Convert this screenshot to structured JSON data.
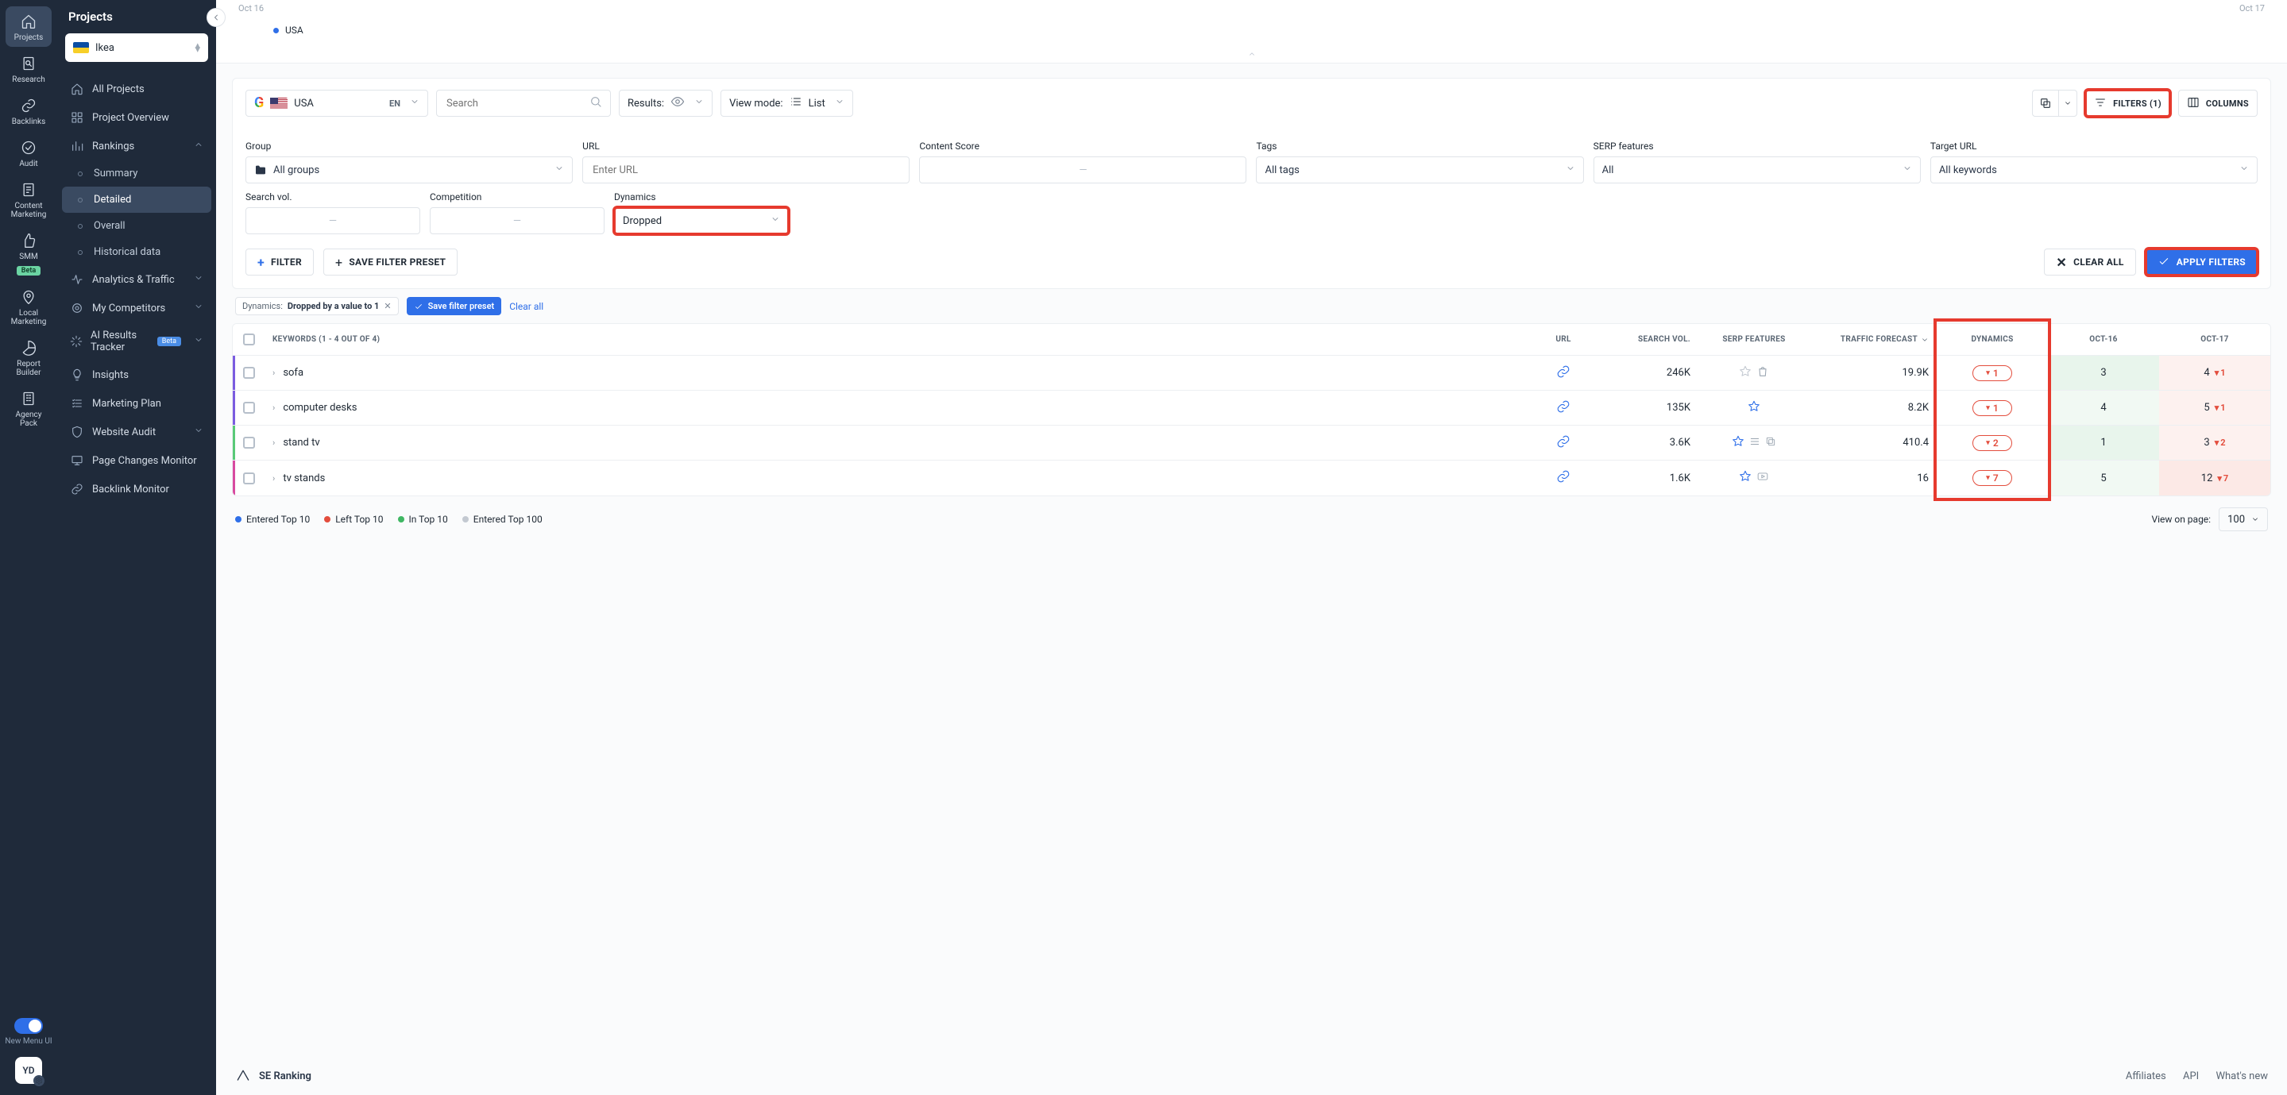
{
  "rail": {
    "items": [
      {
        "label": "Projects",
        "icon": "home-icon",
        "active": true
      },
      {
        "label": "Research",
        "icon": "search-doc-icon"
      },
      {
        "label": "Backlinks",
        "icon": "link-icon"
      },
      {
        "label": "Audit",
        "icon": "check-circle-icon"
      },
      {
        "label": "Content\nMarketing",
        "icon": "edit-doc-icon"
      },
      {
        "label": "SMM",
        "icon": "thumbs-up-icon",
        "beta": "Beta"
      },
      {
        "label": "Local\nMarketing",
        "icon": "pin-icon"
      },
      {
        "label": "Report\nBuilder",
        "icon": "pie-icon"
      },
      {
        "label": "Agency\nPack",
        "icon": "building-icon"
      }
    ],
    "toggle_label": "New Menu UI",
    "avatar": "YD"
  },
  "side": {
    "title": "Projects",
    "project": "Ikea",
    "nav_all": "All Projects",
    "nav_overview": "Project Overview",
    "nav_rankings": "Rankings",
    "rankings_children": [
      "Summary",
      "Detailed",
      "Overall",
      "Historical data"
    ],
    "rankings_selected_index": 1,
    "nav_analytics": "Analytics & Traffic",
    "nav_competitors": "My Competitors",
    "nav_ai": "AI Results Tracker",
    "nav_ai_badge": "Beta",
    "nav_insights": "Insights",
    "nav_marketing": "Marketing Plan",
    "nav_audit": "Website Audit",
    "nav_pagechanges": "Page Changes Monitor",
    "nav_backlink": "Backlink Monitor"
  },
  "top": {
    "date_left": "Oct 16",
    "date_right": "Oct 17",
    "legend_usa": "USA"
  },
  "toolbar": {
    "country": "USA",
    "lang": "EN",
    "search_placeholder": "Search",
    "results_label": "Results:",
    "viewmode_label": "View mode:",
    "viewmode_value": "List",
    "filters_btn": "FILTERS (1)",
    "columns_btn": "COLUMNS"
  },
  "filters": {
    "labels": {
      "group": "Group",
      "url": "URL",
      "content": "Content Score",
      "tags": "Tags",
      "serp": "SERP features",
      "target": "Target URL",
      "searchvol": "Search vol.",
      "competition": "Competition",
      "dynamics": "Dynamics"
    },
    "group_value": "All groups",
    "url_placeholder": "Enter URL",
    "tags_value": "All tags",
    "serp_value": "All",
    "target_value": "All keywords",
    "dynamics_value": "Dropped",
    "add_filter": "FILTER",
    "save_preset": "SAVE FILTER PRESET",
    "clear_all": "CLEAR ALL",
    "apply": "APPLY FILTERS"
  },
  "chips": {
    "chip_label": "Dynamics:",
    "chip_value": "Dropped by a value to 1",
    "save": "Save filter preset",
    "clear": "Clear all"
  },
  "table": {
    "header_keywords": "KEYWORDS (1 - 4 OUT OF 4)",
    "header_url": "URL",
    "header_searchvol": "SEARCH VOL.",
    "header_serp": "SERP FEATURES",
    "header_traffic": "TRAFFIC FORECAST",
    "header_dynamics": "DYNAMICS",
    "header_oct16": "OCT-16",
    "header_oct17": "OCT-17",
    "rows": [
      {
        "accent": "acc-purple",
        "keyword": "sofa",
        "search_vol": "246K",
        "serp": [
          "star-grey",
          "bag"
        ],
        "traffic": "19.9K",
        "dynamics": "1",
        "oct16": {
          "pos": "3",
          "class": "green"
        },
        "oct17": {
          "pos": "4",
          "delta": "1",
          "class": "lred"
        }
      },
      {
        "accent": "acc-purple",
        "keyword": "computer desks",
        "search_vol": "135K",
        "serp": [
          "star"
        ],
        "traffic": "8.2K",
        "dynamics": "1",
        "oct16": {
          "pos": "4",
          "class": "lgreen"
        },
        "oct17": {
          "pos": "5",
          "delta": "1",
          "class": "lred"
        }
      },
      {
        "accent": "acc-green",
        "keyword": "stand tv",
        "search_vol": "3.6K",
        "serp": [
          "star",
          "list",
          "copy"
        ],
        "traffic": "410.4",
        "dynamics": "2",
        "oct16": {
          "pos": "1",
          "class": "green"
        },
        "oct17": {
          "pos": "3",
          "delta": "2",
          "class": "lred"
        }
      },
      {
        "accent": "acc-pink",
        "keyword": "tv stands",
        "search_vol": "1.6K",
        "serp": [
          "star",
          "video"
        ],
        "traffic": "16",
        "dynamics": "7",
        "oct16": {
          "pos": "5",
          "class": "lgreen"
        },
        "oct17": {
          "pos": "12",
          "delta": "7",
          "class": "red"
        }
      }
    ]
  },
  "legend": {
    "entered10": "Entered Top 10",
    "left10": "Left Top 10",
    "in10": "In Top 10",
    "entered100": "Entered Top 100",
    "view_on": "View on page:",
    "per_page": "100"
  },
  "footer": {
    "brand": "SE Ranking",
    "affiliates": "Affiliates",
    "api": "API",
    "whatsnew": "What's new"
  }
}
